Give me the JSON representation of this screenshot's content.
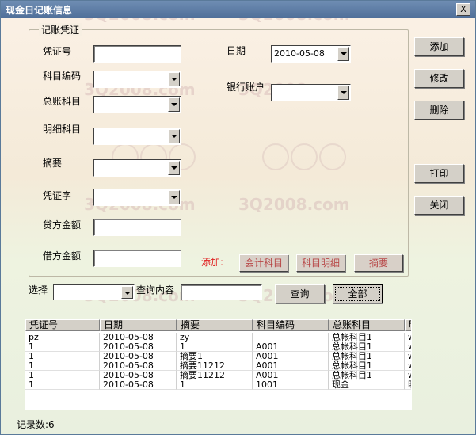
{
  "window": {
    "title": "现金日记账信息",
    "close_symbol": "X"
  },
  "watermark": {
    "text": "3Q2008.com"
  },
  "form": {
    "group_title": "记账凭证",
    "voucher_no_label": "凭证号",
    "subject_code_label": "科目编码",
    "ledger_subject_label": "总账科目",
    "detail_subject_label": "明细科目",
    "summary_label": "摘要",
    "voucher_word_label": "凭证字",
    "credit_amount_label": "贷方金额",
    "debit_amount_label": "借方金额",
    "date_label": "日期",
    "date_value": "2010-05-08",
    "bank_account_label": "银行账户",
    "add_label": "添加:",
    "add_accounting_subject_button": "会计科目",
    "add_subject_detail_button": "科目明细",
    "add_summary_button": "摘要"
  },
  "side_buttons": {
    "add": "添加",
    "modify": "修改",
    "delete": "删除",
    "print": "打印",
    "close": "关闭"
  },
  "search": {
    "select_label": "选择",
    "query_content_label": "查询内容",
    "query_button": "查询",
    "all_button": "全部"
  },
  "table": {
    "columns": [
      "凭证号",
      "日期",
      "摘要",
      "科目编码",
      "总账科目",
      "明"
    ],
    "rows": [
      [
        "pz",
        "2010-05-08",
        "zy",
        "",
        "总帐科目1",
        "w"
      ],
      [
        "1",
        "2010-05-08",
        "1",
        "A001",
        "总帐科目1",
        "w"
      ],
      [
        "1",
        "2010-05-08",
        "摘要1",
        "A001",
        "总帐科目1",
        "w"
      ],
      [
        "1",
        "2010-05-08",
        "摘要11212",
        "A001",
        "总帐科目1",
        "w"
      ],
      [
        "1",
        "2010-05-08",
        "摘要11212",
        "A001",
        "总帐科目1",
        "w"
      ],
      [
        "1",
        "2010-05-08",
        "1",
        "1001",
        "现金",
        "明"
      ]
    ]
  },
  "status": {
    "record_count": "记录数:6"
  }
}
